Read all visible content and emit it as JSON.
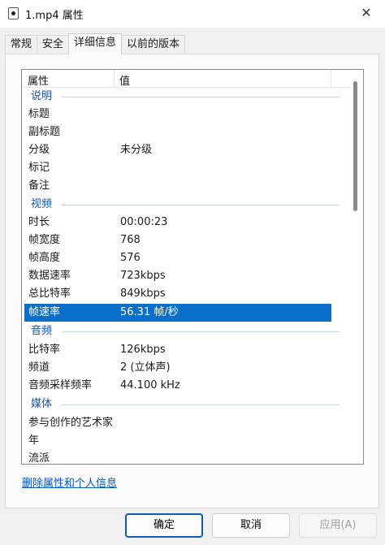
{
  "window": {
    "title": "1.mp4 属性",
    "close_glyph": "✕",
    "icon": "media-file-icon"
  },
  "tabs": [
    {
      "label": "常规"
    },
    {
      "label": "安全"
    },
    {
      "label": "详细信息",
      "active": true
    },
    {
      "label": "以前的版本"
    }
  ],
  "list": {
    "header": {
      "name": "属性",
      "value": "值"
    },
    "groups": {
      "description": "说明",
      "video": "视频",
      "audio": "音频",
      "media": "媒体"
    },
    "rows": {
      "title": {
        "k": "标题",
        "v": ""
      },
      "subtitle": {
        "k": "副标题",
        "v": ""
      },
      "rating": {
        "k": "分级",
        "v": "未分级"
      },
      "tags": {
        "k": "标记",
        "v": ""
      },
      "comments": {
        "k": "备注",
        "v": ""
      },
      "length": {
        "k": "时长",
        "v": "00:00:23"
      },
      "frame_width": {
        "k": "帧宽度",
        "v": "768"
      },
      "frame_height": {
        "k": "帧高度",
        "v": "576"
      },
      "data_rate": {
        "k": "数据速率",
        "v": "723kbps"
      },
      "total_bitrate": {
        "k": "总比特率",
        "v": "849kbps"
      },
      "frame_rate": {
        "k": "帧速率",
        "v": "56.31 帧/秒",
        "selected": true
      },
      "bitrate": {
        "k": "比特率",
        "v": "126kbps"
      },
      "channels": {
        "k": "频道",
        "v": "2 (立体声)"
      },
      "sample_rate": {
        "k": "音频采样频率",
        "v": "44.100 kHz"
      },
      "contributing_artists": {
        "k": "参与创作的艺术家",
        "v": ""
      },
      "year": {
        "k": "年",
        "v": ""
      },
      "genre": {
        "k": "流派",
        "v": ""
      }
    }
  },
  "remove_link": "删除属性和个人信息",
  "buttons": {
    "ok": "确定",
    "cancel": "取消",
    "apply": "应用(A)"
  },
  "colors": {
    "selection": "#0a6ecb",
    "group_label": "#1a55a8",
    "link": "#0b58c2"
  }
}
